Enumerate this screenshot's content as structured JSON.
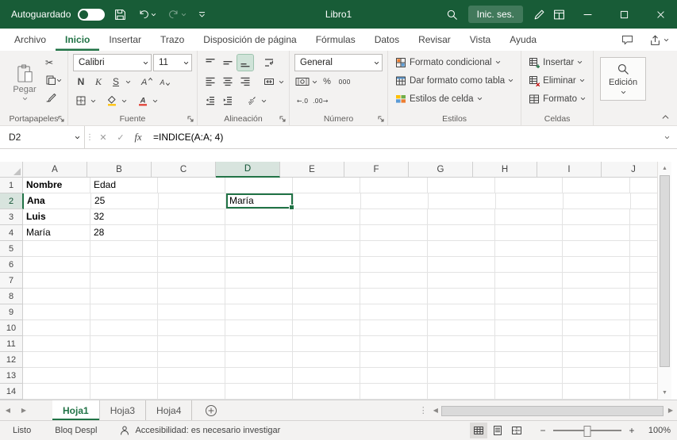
{
  "titlebar": {
    "autosave_label": "Autoguardado",
    "document_title": "Libro1",
    "sign_in_label": "Inic. ses."
  },
  "ribbon_tabs": {
    "items": [
      {
        "label": "Archivo"
      },
      {
        "label": "Inicio",
        "active": true
      },
      {
        "label": "Insertar"
      },
      {
        "label": "Trazo"
      },
      {
        "label": "Disposición de página"
      },
      {
        "label": "Fórmulas"
      },
      {
        "label": "Datos"
      },
      {
        "label": "Revisar"
      },
      {
        "label": "Vista"
      },
      {
        "label": "Ayuda"
      }
    ]
  },
  "ribbon": {
    "paste_label": "Pegar",
    "font_name": "Calibri",
    "font_size": "11",
    "bold_label": "N",
    "italic_label": "K",
    "underline_label": "S",
    "number_format": "General",
    "styles": {
      "conditional": "Formato condicional",
      "format_as_table": "Dar formato como tabla",
      "cell_styles": "Estilos de celda"
    },
    "cells": {
      "insert": "Insertar",
      "delete": "Eliminar",
      "format": "Formato"
    },
    "editing_label": "Edición",
    "group_labels": {
      "clipboard": "Portapapeles",
      "font": "Fuente",
      "alignment": "Alineación",
      "number": "Número",
      "styles": "Estilos",
      "cells": "Celdas"
    }
  },
  "formula_bar": {
    "name_box": "D2",
    "fx_label": "fx",
    "formula": "=INDICE(A:A; 4)"
  },
  "grid": {
    "columns": [
      "A",
      "B",
      "C",
      "D",
      "E",
      "F",
      "G",
      "H",
      "I",
      "J"
    ],
    "row_count": 14,
    "selected": {
      "cell": "D2",
      "column": "D",
      "row": 2
    },
    "cells": {
      "A1": {
        "text": "Nombre",
        "bold": true
      },
      "B1": {
        "text": "Edad"
      },
      "A2": {
        "text": "Ana",
        "bold": true
      },
      "B2": {
        "text": "25"
      },
      "A3": {
        "text": "Luis",
        "bold": true
      },
      "B3": {
        "text": "32"
      },
      "A4": {
        "text": "María"
      },
      "B4": {
        "text": "28"
      },
      "D2": {
        "text": "María"
      }
    }
  },
  "sheet_bar": {
    "tabs": [
      {
        "label": "Hoja1",
        "active": true
      },
      {
        "label": "Hoja3"
      },
      {
        "label": "Hoja4"
      }
    ]
  },
  "status_bar": {
    "mode": "Listo",
    "scroll_lock": "Bloq Despl",
    "accessibility": "Accesibilidad: es necesario investigar",
    "zoom": "100%"
  },
  "colors": {
    "titlebar_green": "#185C37",
    "accent_green": "#217346",
    "ribbon_bg": "#F3F2F1"
  },
  "icons": {
    "scissors": "✂",
    "cancel": "✕",
    "enter": "✓",
    "percent": "%",
    "thousands": "000",
    "increase_decimal": "←.0",
    "decrease_decimal": ".00→",
    "splitter": "⋮",
    "nav_left": "◀",
    "nav_right": "▶",
    "up_arrow": "▲",
    "down_arrow": "▼",
    "zoom_out": "−",
    "zoom_in": "+"
  }
}
